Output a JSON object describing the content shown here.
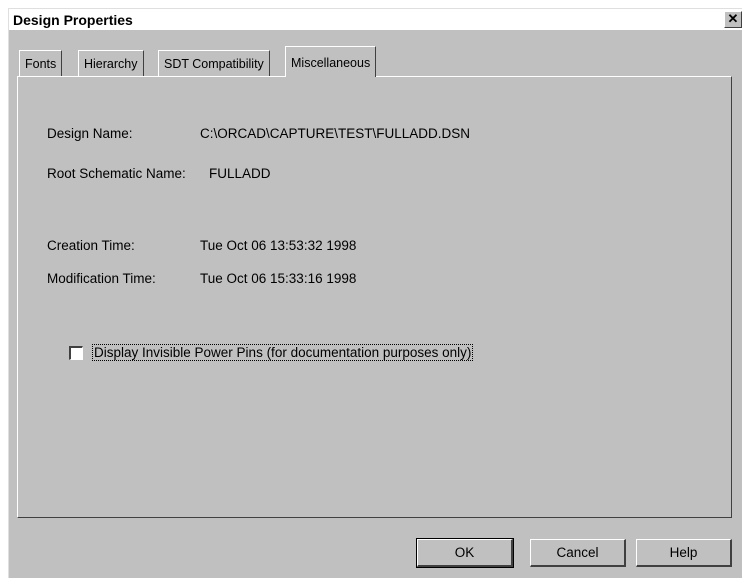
{
  "window": {
    "title": "Design Properties",
    "close_label": "✕"
  },
  "tabs": [
    {
      "label": "Fonts",
      "active": false
    },
    {
      "label": "Hierarchy",
      "active": false
    },
    {
      "label": "SDT Compatibility",
      "active": false
    },
    {
      "label": "Miscellaneous",
      "active": true
    }
  ],
  "misc": {
    "design_name_label": "Design Name:",
    "design_name_value": "C:\\ORCAD\\CAPTURE\\TEST\\FULLADD.DSN",
    "root_schematic_label": "Root Schematic Name:",
    "root_schematic_value": "FULLADD",
    "creation_time_label": "Creation Time:",
    "creation_time_value": "Tue Oct 06 13:53:32 1998",
    "modification_time_label": "Modification Time:",
    "modification_time_value": "Tue Oct 06 15:33:16 1998",
    "power_pins_checkbox_label": "Display Invisible Power Pins (for documentation purposes only)",
    "power_pins_checked": false
  },
  "buttons": {
    "ok": "OK",
    "cancel": "Cancel",
    "help": "Help"
  }
}
